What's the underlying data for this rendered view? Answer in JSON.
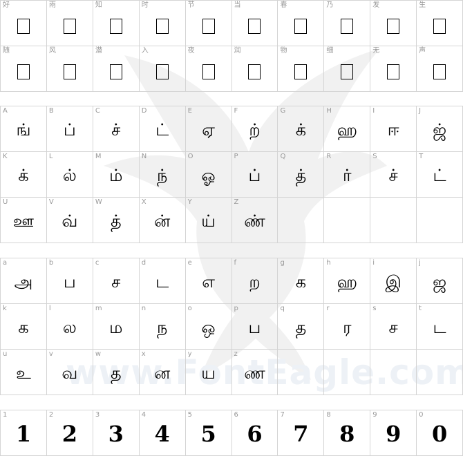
{
  "watermark": {
    "text": "www.FontEagle.com",
    "icon": "eagle-icon"
  },
  "section_cjk": {
    "rows": [
      [
        {
          "label": "好"
        },
        {
          "label": "雨"
        },
        {
          "label": "知"
        },
        {
          "label": "时"
        },
        {
          "label": "节"
        },
        {
          "label": "当"
        },
        {
          "label": "春"
        },
        {
          "label": "乃"
        },
        {
          "label": "发"
        },
        {
          "label": "生"
        }
      ],
      [
        {
          "label": "随"
        },
        {
          "label": "风"
        },
        {
          "label": "潜"
        },
        {
          "label": "入"
        },
        {
          "label": "夜"
        },
        {
          "label": "润"
        },
        {
          "label": "物"
        },
        {
          "label": "细"
        },
        {
          "label": "无"
        },
        {
          "label": "声"
        }
      ]
    ]
  },
  "section_upper": {
    "rows": [
      [
        {
          "label": "A",
          "glyph": "ங்"
        },
        {
          "label": "B",
          "glyph": "ப்"
        },
        {
          "label": "C",
          "glyph": "ச்"
        },
        {
          "label": "D",
          "glyph": "ட்"
        },
        {
          "label": "E",
          "glyph": "ஏ"
        },
        {
          "label": "F",
          "glyph": "ற்"
        },
        {
          "label": "G",
          "glyph": "க்"
        },
        {
          "label": "H",
          "glyph": "ஹ"
        },
        {
          "label": "I",
          "glyph": "ஈ"
        },
        {
          "label": "J",
          "glyph": "ஜ்"
        }
      ],
      [
        {
          "label": "K",
          "glyph": "க்"
        },
        {
          "label": "L",
          "glyph": "ல்"
        },
        {
          "label": "M",
          "glyph": "ம்"
        },
        {
          "label": "N",
          "glyph": "ந்"
        },
        {
          "label": "O",
          "glyph": "ஓ"
        },
        {
          "label": "P",
          "glyph": "ப்"
        },
        {
          "label": "Q",
          "glyph": "த்"
        },
        {
          "label": "R",
          "glyph": "ர்"
        },
        {
          "label": "S",
          "glyph": "ச்"
        },
        {
          "label": "T",
          "glyph": "ட்"
        }
      ],
      [
        {
          "label": "U",
          "glyph": "ஊ"
        },
        {
          "label": "V",
          "glyph": "வ்"
        },
        {
          "label": "W",
          "glyph": "த்"
        },
        {
          "label": "X",
          "glyph": "ன்"
        },
        {
          "label": "Y",
          "glyph": "ய்"
        },
        {
          "label": "Z",
          "glyph": "ண்"
        },
        {
          "label": "",
          "glyph": ""
        },
        {
          "label": "",
          "glyph": ""
        },
        {
          "label": "",
          "glyph": ""
        },
        {
          "label": "",
          "glyph": ""
        }
      ]
    ]
  },
  "section_lower": {
    "rows": [
      [
        {
          "label": "a",
          "glyph": "அ"
        },
        {
          "label": "b",
          "glyph": "ப"
        },
        {
          "label": "c",
          "glyph": "ச"
        },
        {
          "label": "d",
          "glyph": "ட"
        },
        {
          "label": "e",
          "glyph": "எ"
        },
        {
          "label": "f",
          "glyph": "ற"
        },
        {
          "label": "g",
          "glyph": "க"
        },
        {
          "label": "h",
          "glyph": "ஹ"
        },
        {
          "label": "i",
          "glyph": "இ"
        },
        {
          "label": "j",
          "glyph": "ஜ"
        }
      ],
      [
        {
          "label": "k",
          "glyph": "க"
        },
        {
          "label": "l",
          "glyph": "ல"
        },
        {
          "label": "m",
          "glyph": "ம"
        },
        {
          "label": "n",
          "glyph": "ந"
        },
        {
          "label": "o",
          "glyph": "ஒ"
        },
        {
          "label": "p",
          "glyph": "ப"
        },
        {
          "label": "q",
          "glyph": "த"
        },
        {
          "label": "r",
          "glyph": "ர"
        },
        {
          "label": "s",
          "glyph": "ச"
        },
        {
          "label": "t",
          "glyph": "ட"
        }
      ],
      [
        {
          "label": "u",
          "glyph": "உ"
        },
        {
          "label": "v",
          "glyph": "வ"
        },
        {
          "label": "w",
          "glyph": "த"
        },
        {
          "label": "x",
          "glyph": "ன"
        },
        {
          "label": "y",
          "glyph": "ய"
        },
        {
          "label": "z",
          "glyph": "ண"
        },
        {
          "label": "",
          "glyph": ""
        },
        {
          "label": "",
          "glyph": ""
        },
        {
          "label": "",
          "glyph": ""
        },
        {
          "label": "",
          "glyph": ""
        }
      ]
    ]
  },
  "section_digits": {
    "rows": [
      [
        {
          "label": "1",
          "glyph": "1"
        },
        {
          "label": "2",
          "glyph": "2"
        },
        {
          "label": "3",
          "glyph": "3"
        },
        {
          "label": "4",
          "glyph": "4"
        },
        {
          "label": "5",
          "glyph": "5"
        },
        {
          "label": "6",
          "glyph": "6"
        },
        {
          "label": "7",
          "glyph": "7"
        },
        {
          "label": "8",
          "glyph": "8"
        },
        {
          "label": "9",
          "glyph": "9"
        },
        {
          "label": "0",
          "glyph": "0"
        }
      ]
    ]
  }
}
